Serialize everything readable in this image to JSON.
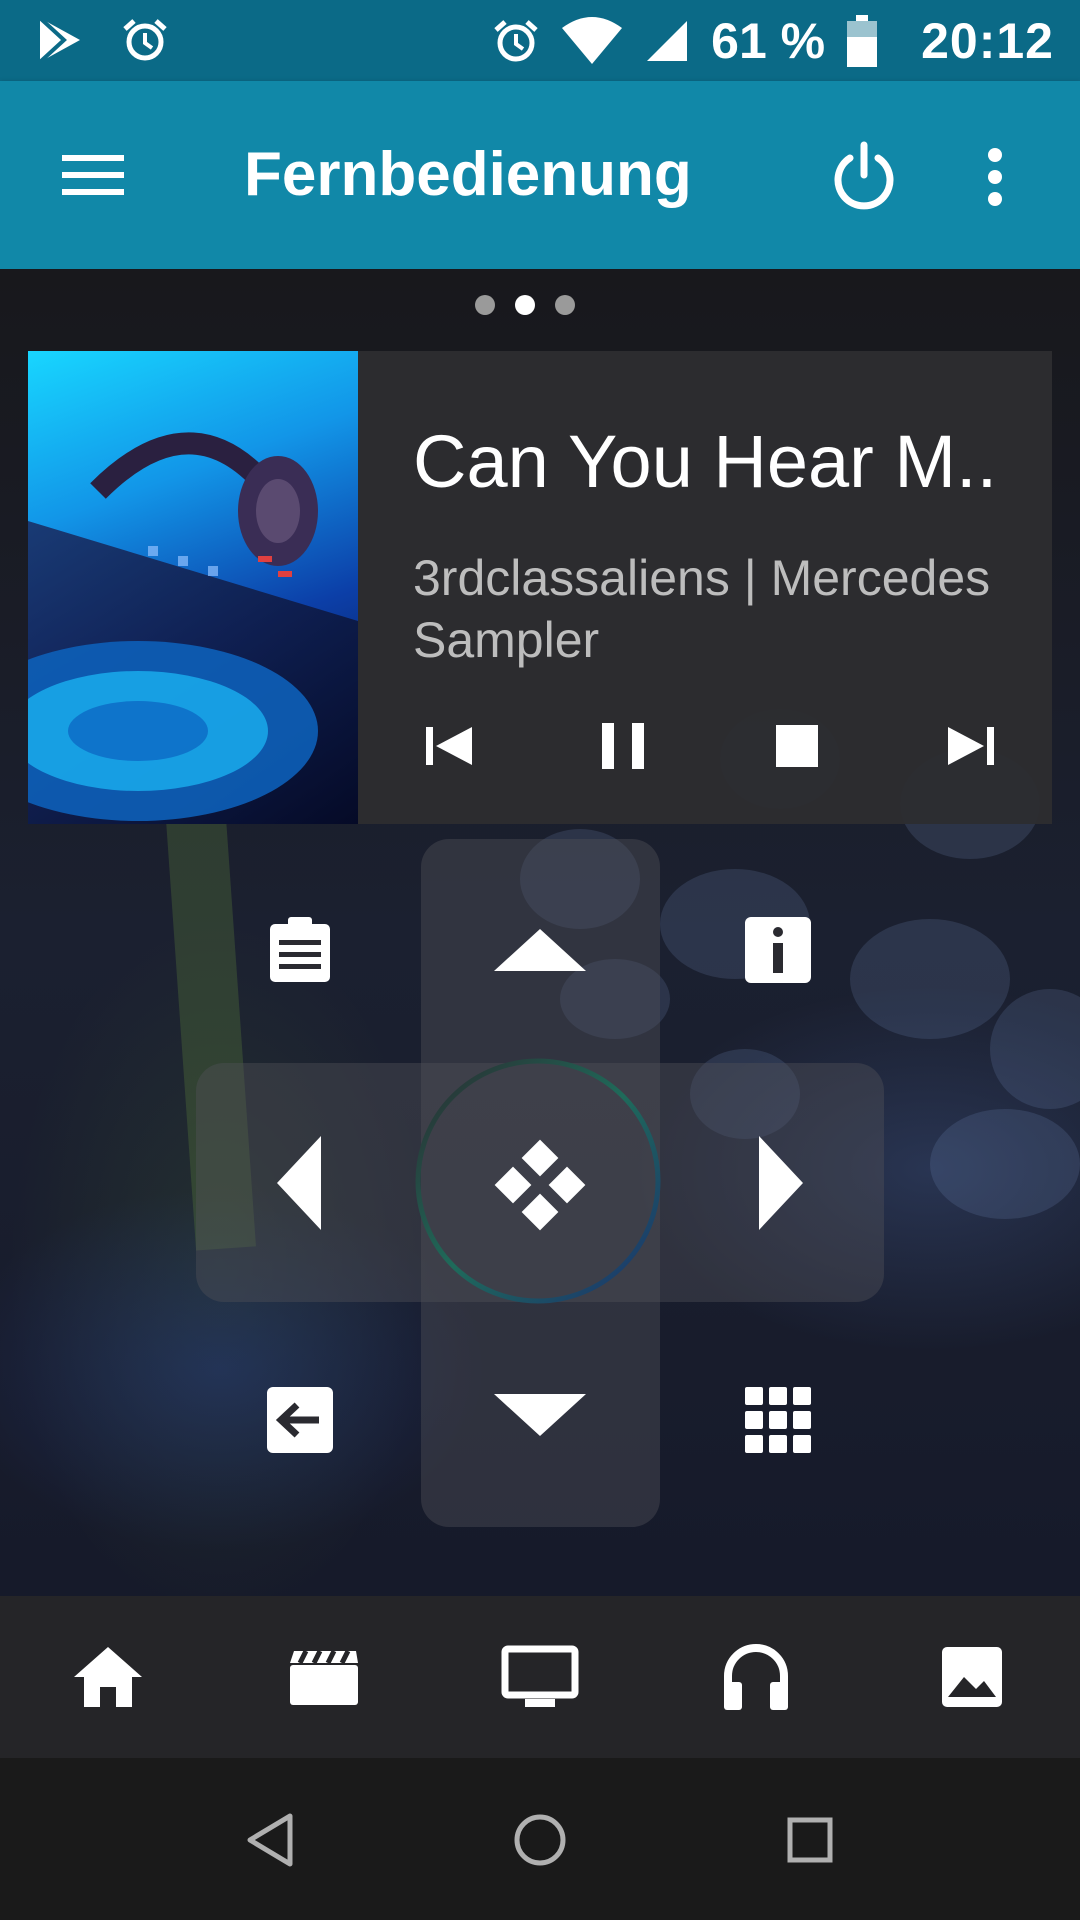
{
  "status_bar": {
    "left_icons": [
      "play-store-icon",
      "alarm-icon"
    ],
    "right_icons": [
      "alarm-icon",
      "wifi-icon",
      "signal-icon",
      "battery-icon"
    ],
    "battery_percent": "61 %",
    "time": "20:12"
  },
  "toolbar": {
    "title": "Fernbedienung",
    "menu_icon": "hamburger-menu-icon",
    "power_icon": "power-icon",
    "more_icon": "more-vert-icon"
  },
  "pager": {
    "count": 3,
    "active_index": 1
  },
  "now_playing": {
    "title": "Can You Hear M..",
    "artist_album": "3rdclassaliens | Mercedes Sampler",
    "controls": [
      "skip-previous-icon",
      "pause-icon",
      "stop-icon",
      "skip-next-icon"
    ]
  },
  "remote": {
    "buttons": [
      "playlist-icon",
      "up-arrow-icon",
      "info-icon",
      "left-arrow-icon",
      "select-icon",
      "right-arrow-icon",
      "back-icon",
      "down-arrow-icon",
      "grid-icon"
    ]
  },
  "bottom_nav": {
    "items": [
      "home-icon",
      "movies-icon",
      "tv-icon",
      "music-icon",
      "pictures-icon"
    ]
  },
  "system_nav": {
    "items": [
      "back-triangle-icon",
      "home-circle-icon",
      "recents-square-icon"
    ]
  },
  "colors": {
    "status_bar": "#0b6a87",
    "toolbar": "#1188a8",
    "card": "#2d2d30",
    "bottom_nav": "#252528",
    "system_nav": "#1a1a1a"
  }
}
